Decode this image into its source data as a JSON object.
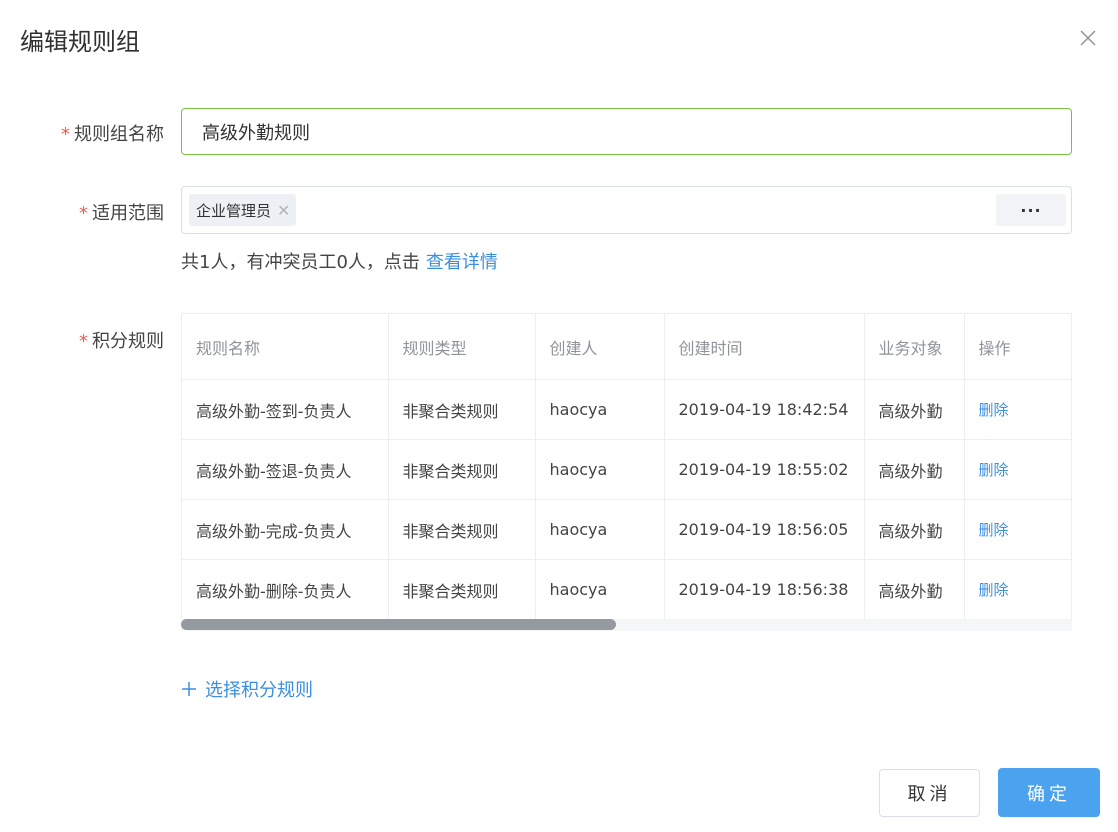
{
  "dialog": {
    "title": "编辑规则组"
  },
  "form": {
    "name_label": "规则组名称",
    "name_value": "高级外勤规则",
    "scope_label": "适用范围",
    "scope_tags": [
      "企业管理员"
    ],
    "scope_more": "···",
    "summary_text": "共1人，有冲突员工0人，点击",
    "summary_link": "查看详情",
    "rules_label": "积分规则",
    "required_mark": "*"
  },
  "table": {
    "columns": [
      "规则名称",
      "规则类型",
      "创建人",
      "创建时间",
      "业务对象",
      "操作"
    ],
    "rows": [
      [
        "高级外勤-签到-负责人",
        "非聚合类规则",
        "haocya",
        "2019-04-19 18:42:54",
        "高级外勤",
        "删除"
      ],
      [
        "高级外勤-签退-负责人",
        "非聚合类规则",
        "haocya",
        "2019-04-19 18:55:02",
        "高级外勤",
        "删除"
      ],
      [
        "高级外勤-完成-负责人",
        "非聚合类规则",
        "haocya",
        "2019-04-19 18:56:05",
        "高级外勤",
        "删除"
      ],
      [
        "高级外勤-删除-负责人",
        "非聚合类规则",
        "haocya",
        "2019-04-19 18:56:38",
        "高级外勤",
        "删除"
      ]
    ]
  },
  "actions": {
    "add_rule": "选择积分规则",
    "cancel": "取消",
    "confirm": "确定"
  },
  "colors": {
    "accent": "#3a8fe0",
    "primary_button": "#4ba3ef",
    "required": "#f5584c",
    "focus_border": "#7ac142"
  },
  "icons": {
    "close": "close-icon",
    "plus": "plus-icon",
    "tag_close": "close-icon"
  }
}
